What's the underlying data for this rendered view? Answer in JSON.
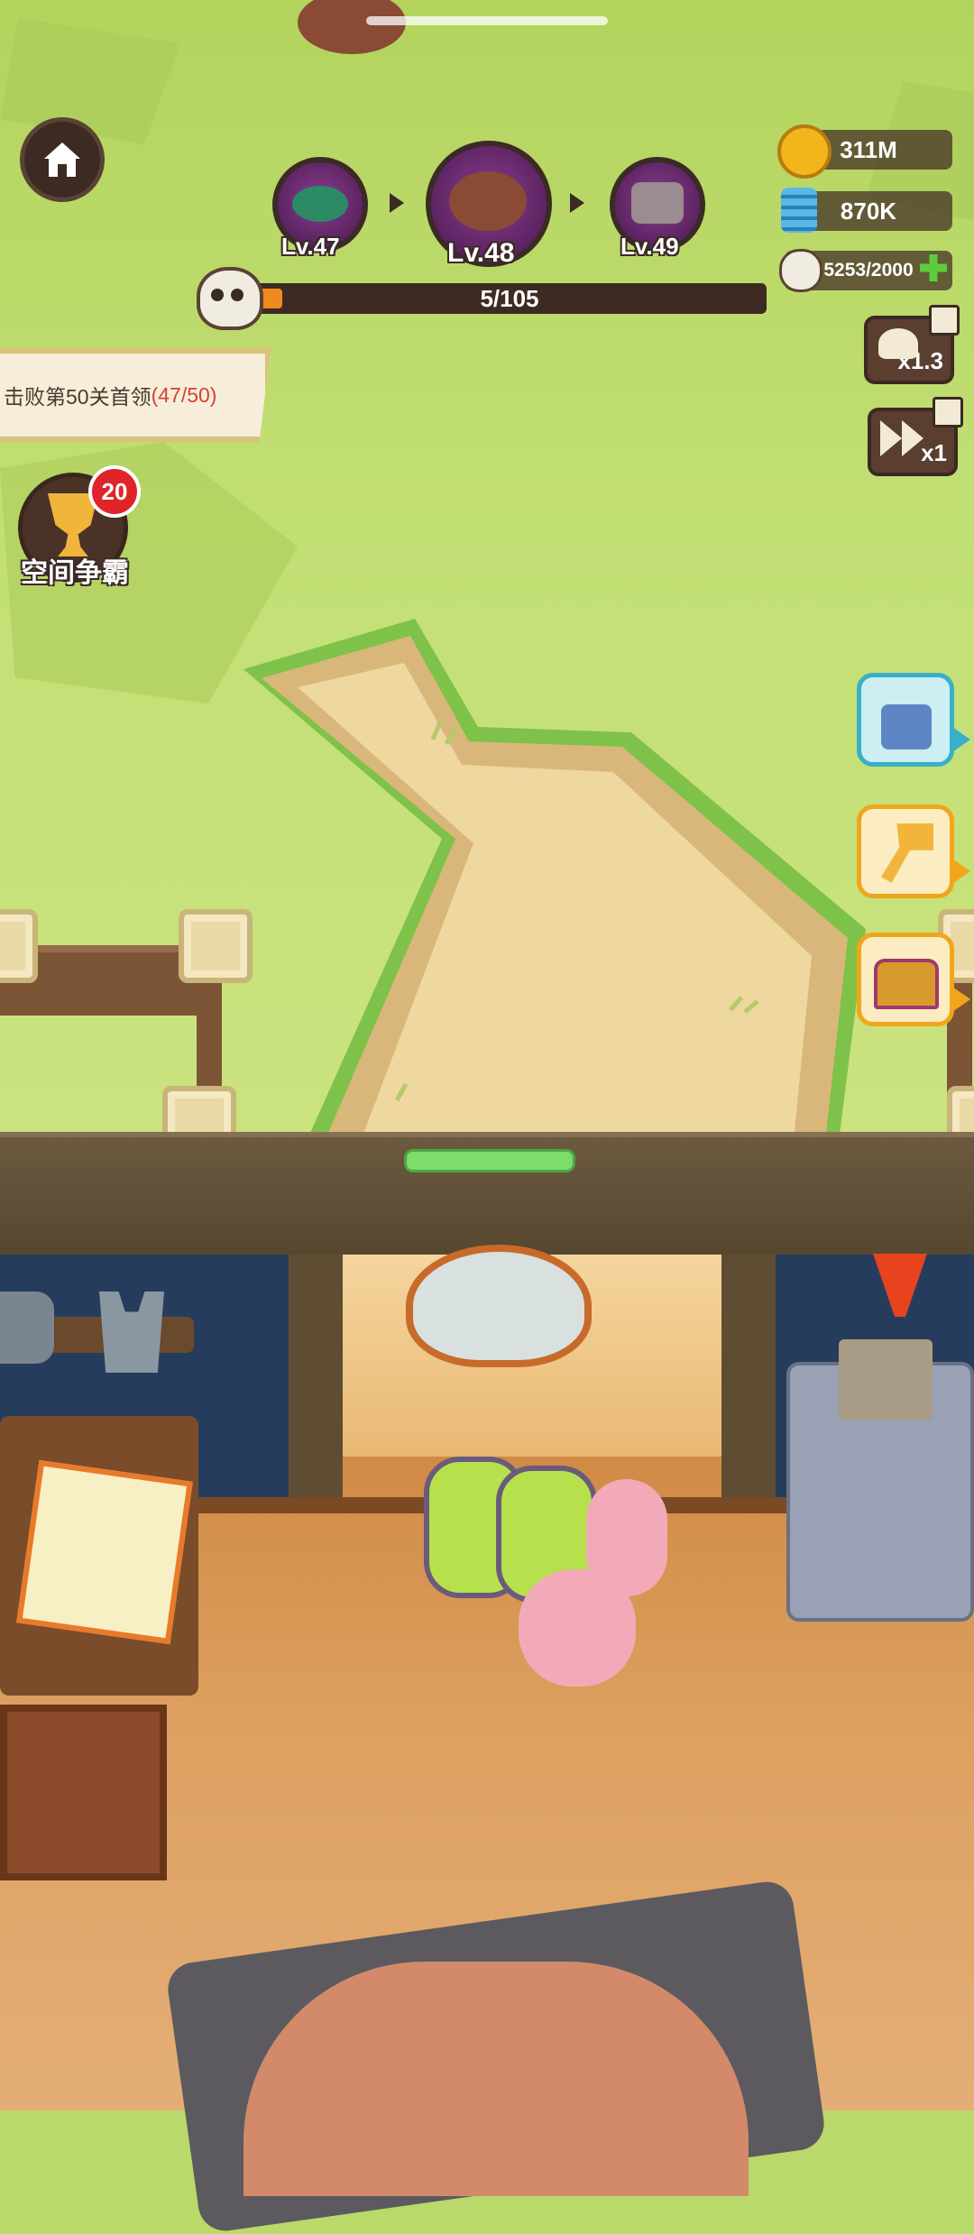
{
  "hud": {
    "boss_track": {
      "bosses": [
        {
          "level": "Lv.47",
          "state": "previous"
        },
        {
          "level": "Lv.48",
          "state": "current"
        },
        {
          "level": "Lv.49",
          "state": "next"
        }
      ],
      "kill_progress_text": "5/105",
      "kill_progress_fraction": 0.048
    },
    "resources": {
      "gold": "311M",
      "spring": "870K",
      "skull": "5253/2000"
    },
    "quest": {
      "text": "击败第50关首领",
      "progress": "(47/50)"
    },
    "arena": {
      "label": "空间争霸",
      "badge_count": "20"
    },
    "speed_buttons": [
      {
        "label": "x1.3",
        "icon": "hat-video-icon"
      },
      {
        "label": "x1",
        "icon": "fast-forward-video-icon"
      }
    ],
    "side_buttons": [
      {
        "icon": "robot-gift-icon"
      },
      {
        "icon": "key-icon"
      },
      {
        "icon": "treasure-chest-icon"
      }
    ]
  },
  "colors": {
    "grass": "#b3d35d",
    "path": "#efd7a0",
    "progress_orange": "#f08a1e",
    "badge_red": "#e0242a",
    "side_button_border": "#f0a61c"
  }
}
